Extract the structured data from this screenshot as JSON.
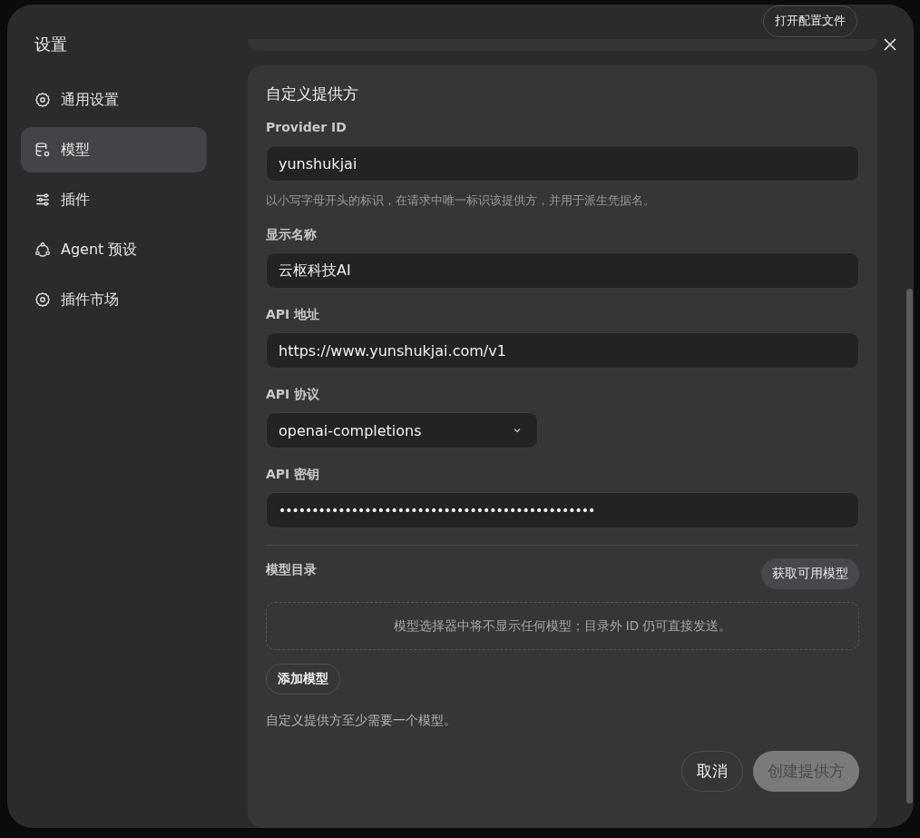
{
  "dialog": {
    "title": "设置",
    "open_config_button": "打开配置文件"
  },
  "sidebar": {
    "items": [
      {
        "label": "通用设置",
        "kind": "gear",
        "selected": false
      },
      {
        "label": "模型",
        "kind": "database",
        "selected": true
      },
      {
        "label": "插件",
        "kind": "sliders",
        "selected": false
      },
      {
        "label": "Agent 预设",
        "kind": "nodes",
        "selected": false
      },
      {
        "label": "插件市场",
        "kind": "gear",
        "selected": false
      }
    ]
  },
  "form": {
    "title": "自定义提供方",
    "fields": [
      {
        "kind": "text",
        "label": "Provider ID",
        "value": "yunshukjai",
        "hint": "以小写字母开头的标识，在请求中唯一标识该提供方，并用于派生凭据名。"
      },
      {
        "kind": "text",
        "label": "显示名称",
        "value": "云枢科技AI"
      },
      {
        "kind": "text",
        "label": "API 地址",
        "value": "https://www.yunshukjai.com/v1"
      },
      {
        "kind": "select",
        "label": "API 协议",
        "value": "openai-completions"
      },
      {
        "kind": "password",
        "label": "API 密钥",
        "value": "••••••••••••••••••••••••••••••••••••••••••••••••"
      }
    ],
    "catalog": {
      "title": "模型目录",
      "fetch_button": "获取可用模型",
      "empty_text": "模型选择器中将不显示任何模型；目录外 ID 仍可直接发送。",
      "add_button": "添加模型",
      "note": "自定义提供方至少需要一个模型。"
    },
    "cancel_button": {
      "label": "取消",
      "disabled": false
    },
    "create_button": {
      "label": "创建提供方",
      "disabled": true
    }
  }
}
